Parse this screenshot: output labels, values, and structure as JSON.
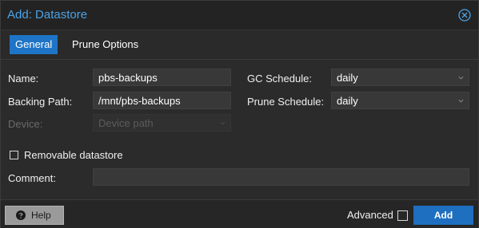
{
  "dialog": {
    "title": "Add: Datastore"
  },
  "tabs": [
    {
      "label": "General",
      "active": true
    },
    {
      "label": "Prune Options",
      "active": false
    }
  ],
  "form": {
    "name": {
      "label": "Name:",
      "value": "pbs-backups"
    },
    "backing_path": {
      "label": "Backing Path:",
      "value": "/mnt/pbs-backups"
    },
    "device": {
      "label": "Device:",
      "placeholder": "Device path",
      "disabled": true
    },
    "gc_schedule": {
      "label": "GC Schedule:",
      "value": "daily"
    },
    "prune_schedule": {
      "label": "Prune Schedule:",
      "value": "daily"
    },
    "removable": {
      "label": "Removable datastore",
      "checked": false
    },
    "comment": {
      "label": "Comment:",
      "value": ""
    }
  },
  "footer": {
    "help_label": "Help",
    "advanced_label": "Advanced",
    "advanced_checked": false,
    "add_label": "Add"
  },
  "colors": {
    "accent": "#1e74c6",
    "title": "#4aa3e8"
  },
  "icons": {
    "close": "close-circle-icon",
    "help": "question-circle-icon",
    "dropdown": "chevron-down-icon"
  }
}
